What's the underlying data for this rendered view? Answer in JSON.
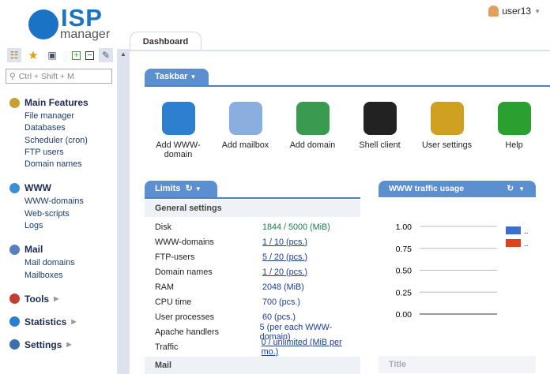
{
  "logo": {
    "brand": "ISP",
    "sub": "manager"
  },
  "user": {
    "name": "user13"
  },
  "search": {
    "placeholder": "Ctrl + Shift + M"
  },
  "nav": [
    {
      "label": "Main Features",
      "color": "#c9a030",
      "items": [
        "File manager",
        "Databases",
        "Scheduler (cron)",
        "FTP users",
        "Domain names"
      ]
    },
    {
      "label": "WWW",
      "color": "#3a8fd8",
      "items": [
        "WWW-domains",
        "Web-scripts",
        "Logs"
      ]
    },
    {
      "label": "Mail",
      "color": "#5a7fc0",
      "items": [
        "Mail domains",
        "Mailboxes"
      ]
    },
    {
      "label": "Tools",
      "color": "#c04030",
      "items": []
    },
    {
      "label": "Statistics",
      "color": "#2a7fd0",
      "items": []
    },
    {
      "label": "Settings",
      "color": "#3a6fb0",
      "items": []
    }
  ],
  "tabs": {
    "dashboard": "Dashboard"
  },
  "taskbar": {
    "title": "Taskbar",
    "items": [
      {
        "label": "Add WWW-domain",
        "color": "#2f7fd0"
      },
      {
        "label": "Add mailbox",
        "color": "#8aaee0"
      },
      {
        "label": "Add domain",
        "color": "#3a9a50"
      },
      {
        "label": "Shell client",
        "color": "#222"
      },
      {
        "label": "User settings",
        "color": "#d0a020"
      },
      {
        "label": "Help",
        "color": "#2aa030"
      }
    ]
  },
  "limits": {
    "title": "Limits",
    "section": "General settings",
    "rows": [
      {
        "k": "Disk",
        "v": "1844 / 5000 (MiB)",
        "link": false,
        "color": "#1c7c50"
      },
      {
        "k": "WWW-domains",
        "v": "1 / 10 (pcs.)",
        "link": true
      },
      {
        "k": "FTP-users",
        "v": "5 / 20 (pcs.)",
        "link": true
      },
      {
        "k": "Domain names",
        "v": "1 / 20 (pcs.)",
        "link": true
      },
      {
        "k": "RAM",
        "v": "2048 (MiB)",
        "link": false
      },
      {
        "k": "CPU time",
        "v": "700 (pcs.)",
        "link": false
      },
      {
        "k": "User processes",
        "v": "60 (pcs.)",
        "link": false
      },
      {
        "k": "Apache handlers",
        "v": "5 (per each WWW-domain)",
        "link": false
      },
      {
        "k": "Traffic",
        "v": "0 / unlimited (MiB per mo.)",
        "link": true
      }
    ],
    "next_section": "Mail"
  },
  "traffic": {
    "title": "WWW traffic usage",
    "footer": "Title"
  },
  "chart_data": {
    "type": "line",
    "title": "WWW traffic usage",
    "ylim": [
      0,
      1
    ],
    "yticks": [
      "1.00",
      "0.75",
      "0.50",
      "0.25",
      "0.00"
    ],
    "series": [
      {
        "name": "..",
        "color": "#3a6fd0",
        "values": []
      },
      {
        "name": "..",
        "color": "#e04020",
        "values": []
      }
    ],
    "legend": "right"
  }
}
